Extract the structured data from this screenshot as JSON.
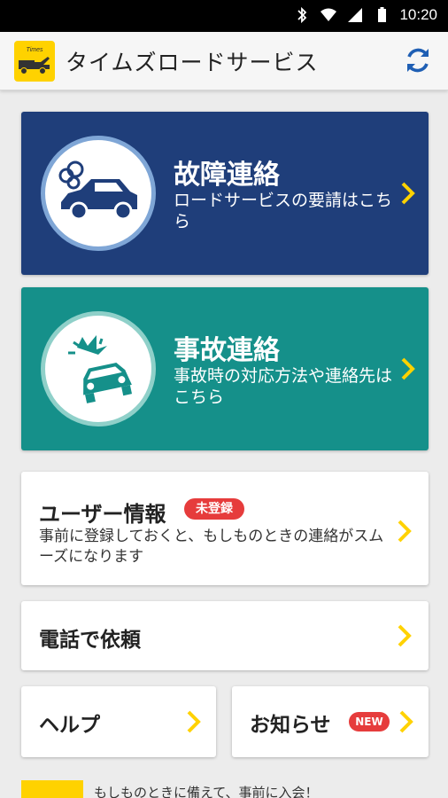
{
  "status_bar": {
    "time": "10:20"
  },
  "app_bar": {
    "title": "タイムズロードサービス",
    "logo_text": "Times"
  },
  "breakdown_card": {
    "title": "故障連絡",
    "subtitle": "ロードサービスの要請はこちら"
  },
  "accident_card": {
    "title": "事故連絡",
    "subtitle": "事故時の対応方法や連絡先はこちら"
  },
  "user_card": {
    "title": "ユーザー情報",
    "badge": "未登録",
    "description": "事前に登録しておくと、もしものときの連絡がスムーズになります"
  },
  "phone_card": {
    "title": "電話で依頼"
  },
  "help_card": {
    "title": "ヘルプ"
  },
  "news_card": {
    "title": "お知らせ",
    "badge": "NEW"
  },
  "banner": {
    "text": "もしものときに備えて、事前に入会！"
  },
  "colors": {
    "accent": "#ffd200",
    "breakdown_bg": "#1f3e7a",
    "accident_bg": "#15908a",
    "badge_red": "#e63c3c"
  }
}
